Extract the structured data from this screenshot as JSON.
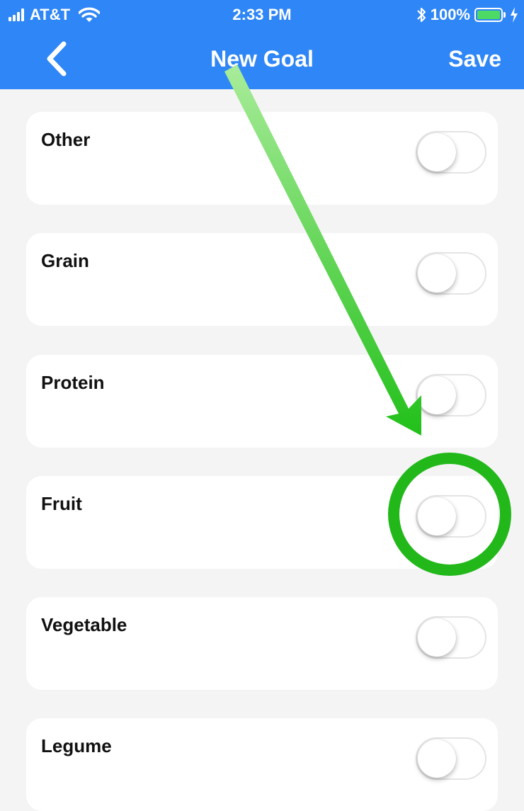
{
  "status_bar": {
    "carrier": "AT&T",
    "time": "2:33 PM",
    "battery": "100%",
    "battery_level": 1.0,
    "battery_color": "#4cd964"
  },
  "nav": {
    "title": "New Goal",
    "save_label": "Save",
    "back_icon": "chevron-left-icon",
    "bar_color": "#2f86f6"
  },
  "categories": [
    {
      "label": "Other",
      "on": false
    },
    {
      "label": "Grain",
      "on": false
    },
    {
      "label": "Protein",
      "on": false
    },
    {
      "label": "Fruit",
      "on": false
    },
    {
      "label": "Vegetable",
      "on": false
    },
    {
      "label": "Legume",
      "on": false
    }
  ],
  "annotation": {
    "arrow_color": "#22c01a",
    "circle_color": "#22b81a",
    "highlighted_category": "Fruit"
  }
}
